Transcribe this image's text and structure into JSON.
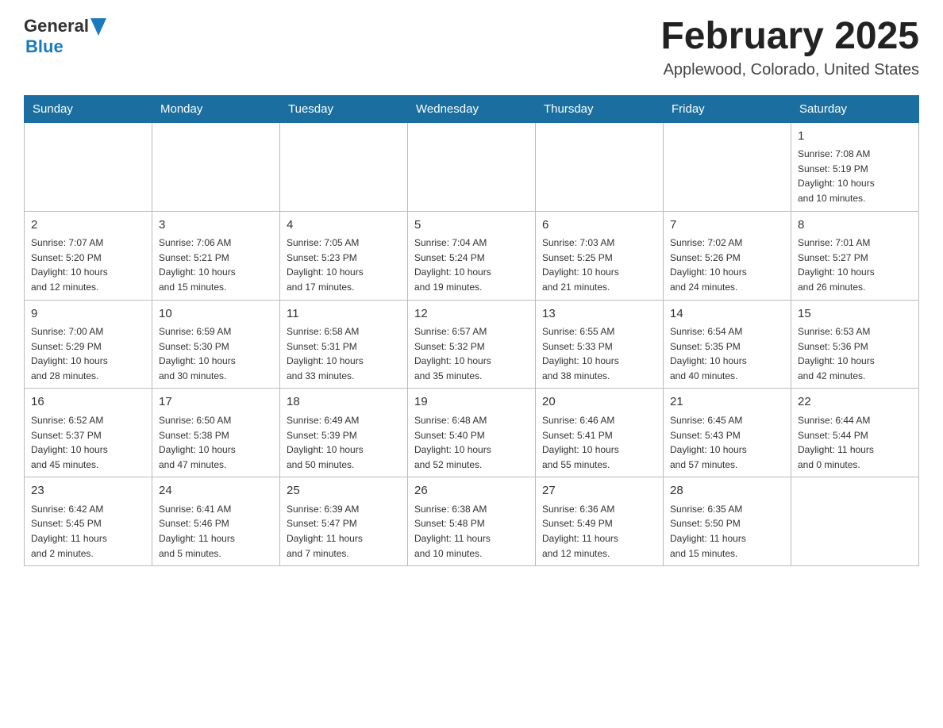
{
  "header": {
    "logo": {
      "general": "General",
      "blue": "Blue",
      "aria": "GeneralBlue logo"
    },
    "title": "February 2025",
    "location": "Applewood, Colorado, United States"
  },
  "calendar": {
    "days_of_week": [
      "Sunday",
      "Monday",
      "Tuesday",
      "Wednesday",
      "Thursday",
      "Friday",
      "Saturday"
    ],
    "weeks": [
      [
        {
          "day": "",
          "info": ""
        },
        {
          "day": "",
          "info": ""
        },
        {
          "day": "",
          "info": ""
        },
        {
          "day": "",
          "info": ""
        },
        {
          "day": "",
          "info": ""
        },
        {
          "day": "",
          "info": ""
        },
        {
          "day": "1",
          "info": "Sunrise: 7:08 AM\nSunset: 5:19 PM\nDaylight: 10 hours\nand 10 minutes."
        }
      ],
      [
        {
          "day": "2",
          "info": "Sunrise: 7:07 AM\nSunset: 5:20 PM\nDaylight: 10 hours\nand 12 minutes."
        },
        {
          "day": "3",
          "info": "Sunrise: 7:06 AM\nSunset: 5:21 PM\nDaylight: 10 hours\nand 15 minutes."
        },
        {
          "day": "4",
          "info": "Sunrise: 7:05 AM\nSunset: 5:23 PM\nDaylight: 10 hours\nand 17 minutes."
        },
        {
          "day": "5",
          "info": "Sunrise: 7:04 AM\nSunset: 5:24 PM\nDaylight: 10 hours\nand 19 minutes."
        },
        {
          "day": "6",
          "info": "Sunrise: 7:03 AM\nSunset: 5:25 PM\nDaylight: 10 hours\nand 21 minutes."
        },
        {
          "day": "7",
          "info": "Sunrise: 7:02 AM\nSunset: 5:26 PM\nDaylight: 10 hours\nand 24 minutes."
        },
        {
          "day": "8",
          "info": "Sunrise: 7:01 AM\nSunset: 5:27 PM\nDaylight: 10 hours\nand 26 minutes."
        }
      ],
      [
        {
          "day": "9",
          "info": "Sunrise: 7:00 AM\nSunset: 5:29 PM\nDaylight: 10 hours\nand 28 minutes."
        },
        {
          "day": "10",
          "info": "Sunrise: 6:59 AM\nSunset: 5:30 PM\nDaylight: 10 hours\nand 30 minutes."
        },
        {
          "day": "11",
          "info": "Sunrise: 6:58 AM\nSunset: 5:31 PM\nDaylight: 10 hours\nand 33 minutes."
        },
        {
          "day": "12",
          "info": "Sunrise: 6:57 AM\nSunset: 5:32 PM\nDaylight: 10 hours\nand 35 minutes."
        },
        {
          "day": "13",
          "info": "Sunrise: 6:55 AM\nSunset: 5:33 PM\nDaylight: 10 hours\nand 38 minutes."
        },
        {
          "day": "14",
          "info": "Sunrise: 6:54 AM\nSunset: 5:35 PM\nDaylight: 10 hours\nand 40 minutes."
        },
        {
          "day": "15",
          "info": "Sunrise: 6:53 AM\nSunset: 5:36 PM\nDaylight: 10 hours\nand 42 minutes."
        }
      ],
      [
        {
          "day": "16",
          "info": "Sunrise: 6:52 AM\nSunset: 5:37 PM\nDaylight: 10 hours\nand 45 minutes."
        },
        {
          "day": "17",
          "info": "Sunrise: 6:50 AM\nSunset: 5:38 PM\nDaylight: 10 hours\nand 47 minutes."
        },
        {
          "day": "18",
          "info": "Sunrise: 6:49 AM\nSunset: 5:39 PM\nDaylight: 10 hours\nand 50 minutes."
        },
        {
          "day": "19",
          "info": "Sunrise: 6:48 AM\nSunset: 5:40 PM\nDaylight: 10 hours\nand 52 minutes."
        },
        {
          "day": "20",
          "info": "Sunrise: 6:46 AM\nSunset: 5:41 PM\nDaylight: 10 hours\nand 55 minutes."
        },
        {
          "day": "21",
          "info": "Sunrise: 6:45 AM\nSunset: 5:43 PM\nDaylight: 10 hours\nand 57 minutes."
        },
        {
          "day": "22",
          "info": "Sunrise: 6:44 AM\nSunset: 5:44 PM\nDaylight: 11 hours\nand 0 minutes."
        }
      ],
      [
        {
          "day": "23",
          "info": "Sunrise: 6:42 AM\nSunset: 5:45 PM\nDaylight: 11 hours\nand 2 minutes."
        },
        {
          "day": "24",
          "info": "Sunrise: 6:41 AM\nSunset: 5:46 PM\nDaylight: 11 hours\nand 5 minutes."
        },
        {
          "day": "25",
          "info": "Sunrise: 6:39 AM\nSunset: 5:47 PM\nDaylight: 11 hours\nand 7 minutes."
        },
        {
          "day": "26",
          "info": "Sunrise: 6:38 AM\nSunset: 5:48 PM\nDaylight: 11 hours\nand 10 minutes."
        },
        {
          "day": "27",
          "info": "Sunrise: 6:36 AM\nSunset: 5:49 PM\nDaylight: 11 hours\nand 12 minutes."
        },
        {
          "day": "28",
          "info": "Sunrise: 6:35 AM\nSunset: 5:50 PM\nDaylight: 11 hours\nand 15 minutes."
        },
        {
          "day": "",
          "info": ""
        }
      ]
    ]
  }
}
